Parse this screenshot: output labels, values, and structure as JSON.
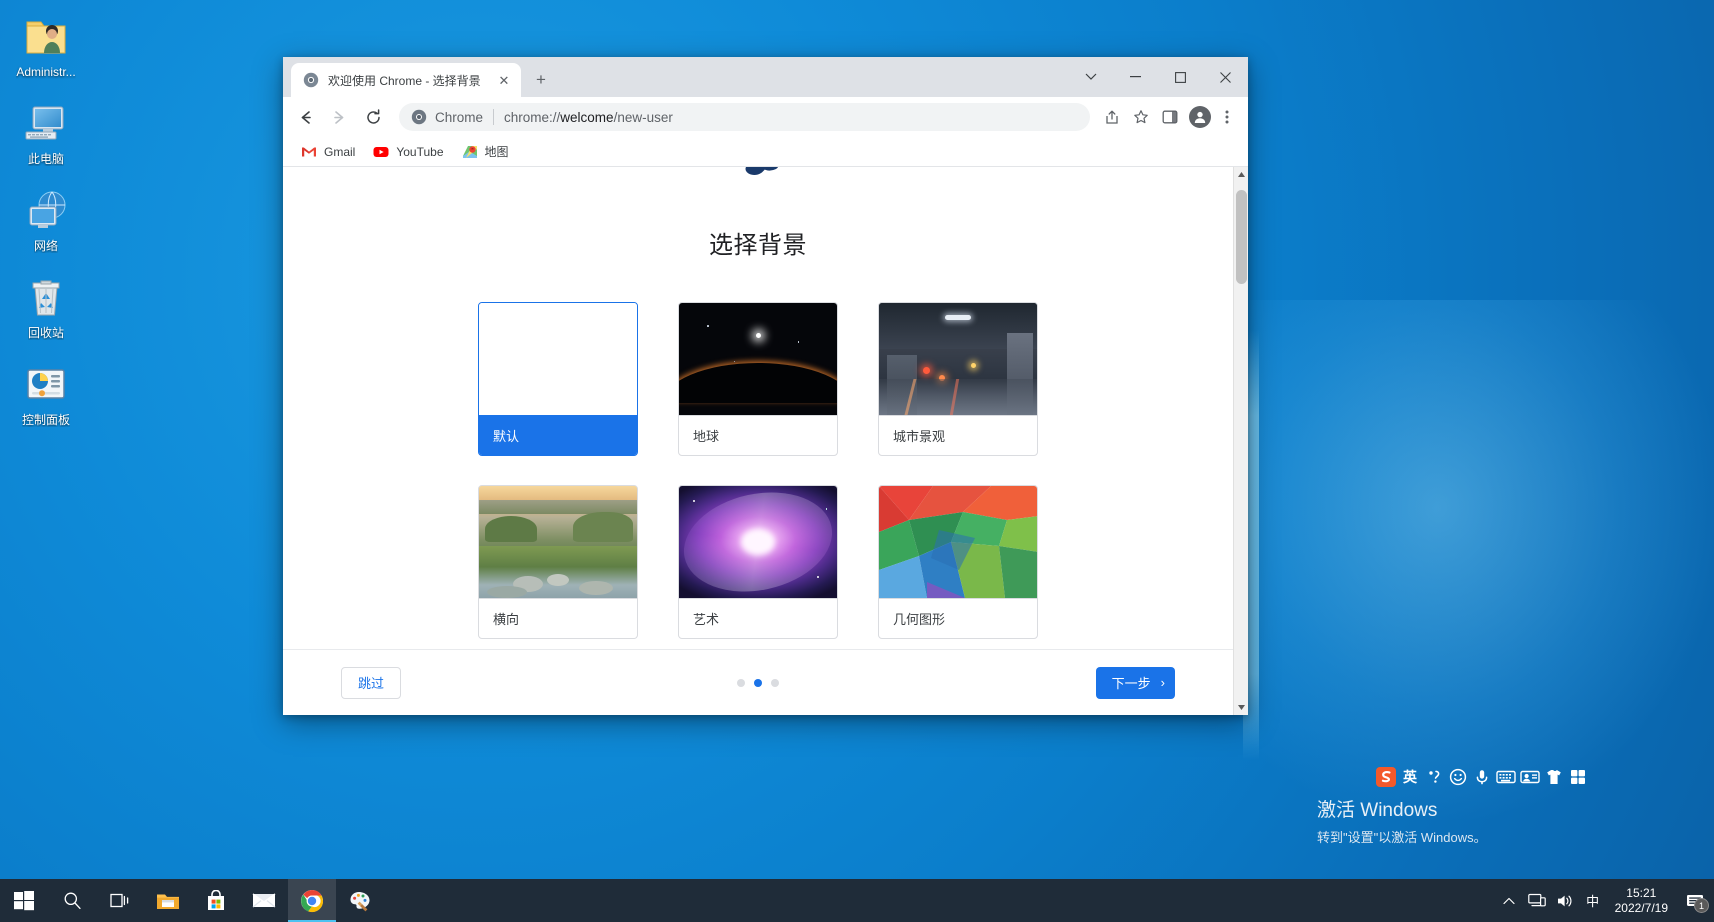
{
  "desktop": {
    "icons": [
      {
        "label": "Administr...",
        "icon": "user-folder-icon"
      },
      {
        "label": "此电脑",
        "icon": "this-pc-icon"
      },
      {
        "label": "网络",
        "icon": "network-icon"
      },
      {
        "label": "回收站",
        "icon": "recycle-bin-icon"
      },
      {
        "label": "控制面板",
        "icon": "control-panel-icon"
      }
    ]
  },
  "browser": {
    "tab": {
      "title": "欢迎使用 Chrome - 选择背景",
      "favicon": "chrome-icon",
      "close_label": "✕"
    },
    "new_tab_label": "+",
    "window_controls": {
      "more": "⌄",
      "minimize": "—",
      "maximize": "▢",
      "close": "✕"
    },
    "toolbar": {
      "back_label": "←",
      "forward_label": "→",
      "reload_label": "⟳",
      "omnibox_scheme": "Chrome",
      "omnibox_url_prefix": "chrome://",
      "omnibox_url_bold": "welcome",
      "omnibox_url_suffix": "/new-user",
      "omnibox_full_url": "chrome://welcome/new-user",
      "share_icon": "share-icon",
      "bookmark_icon": "star-icon",
      "sidepanel_icon": "side-panel-icon",
      "profile_icon": "profile-avatar-icon",
      "menu_icon": "three-dot-menu-icon"
    },
    "bookmarks": [
      {
        "label": "Gmail",
        "icon": "gmail-icon"
      },
      {
        "label": "YouTube",
        "icon": "youtube-icon"
      },
      {
        "label": "地图",
        "icon": "google-maps-icon"
      }
    ]
  },
  "page": {
    "title": "选择背景",
    "backgrounds": [
      {
        "label": "默认",
        "selected": true,
        "thumb": "default-blank"
      },
      {
        "label": "地球",
        "selected": false,
        "thumb": "earth"
      },
      {
        "label": "城市景观",
        "selected": false,
        "thumb": "cityscape"
      },
      {
        "label": "横向",
        "selected": false,
        "thumb": "landscape"
      },
      {
        "label": "艺术",
        "selected": false,
        "thumb": "art"
      },
      {
        "label": "几何图形",
        "selected": false,
        "thumb": "geometric"
      }
    ],
    "footer": {
      "skip_label": "跳过",
      "next_label": "下一步",
      "next_arrow": "›",
      "dots": [
        false,
        true,
        false
      ]
    }
  },
  "ime": {
    "icons": [
      "sogou-logo-icon",
      "english-mode-icon",
      "punctuation-icon",
      "emoji-icon",
      "voice-input-icon",
      "soft-keyboard-icon",
      "user-dictionary-icon",
      "skin-icon",
      "toolbox-icon"
    ],
    "mode_label": "英"
  },
  "watermark": {
    "title": "激活 Windows",
    "subtitle": "转到\"设置\"以激活 Windows。"
  },
  "taskbar": {
    "items": [
      {
        "icon": "windows-start-icon",
        "active": false
      },
      {
        "icon": "search-icon",
        "active": false
      },
      {
        "icon": "task-view-icon",
        "active": false
      },
      {
        "icon": "file-explorer-icon",
        "active": false
      },
      {
        "icon": "microsoft-store-icon",
        "active": false
      },
      {
        "icon": "mail-icon",
        "active": false
      },
      {
        "icon": "chrome-icon",
        "active": true
      },
      {
        "icon": "paint-3d-icon",
        "active": false
      }
    ],
    "tray": {
      "show_hidden_label": "︿",
      "network_icon": "network-tray-icon",
      "volume_icon": "volume-icon",
      "ime_label": "中",
      "time": "15:21",
      "date": "2022/7/19",
      "notification_count": "1"
    }
  }
}
